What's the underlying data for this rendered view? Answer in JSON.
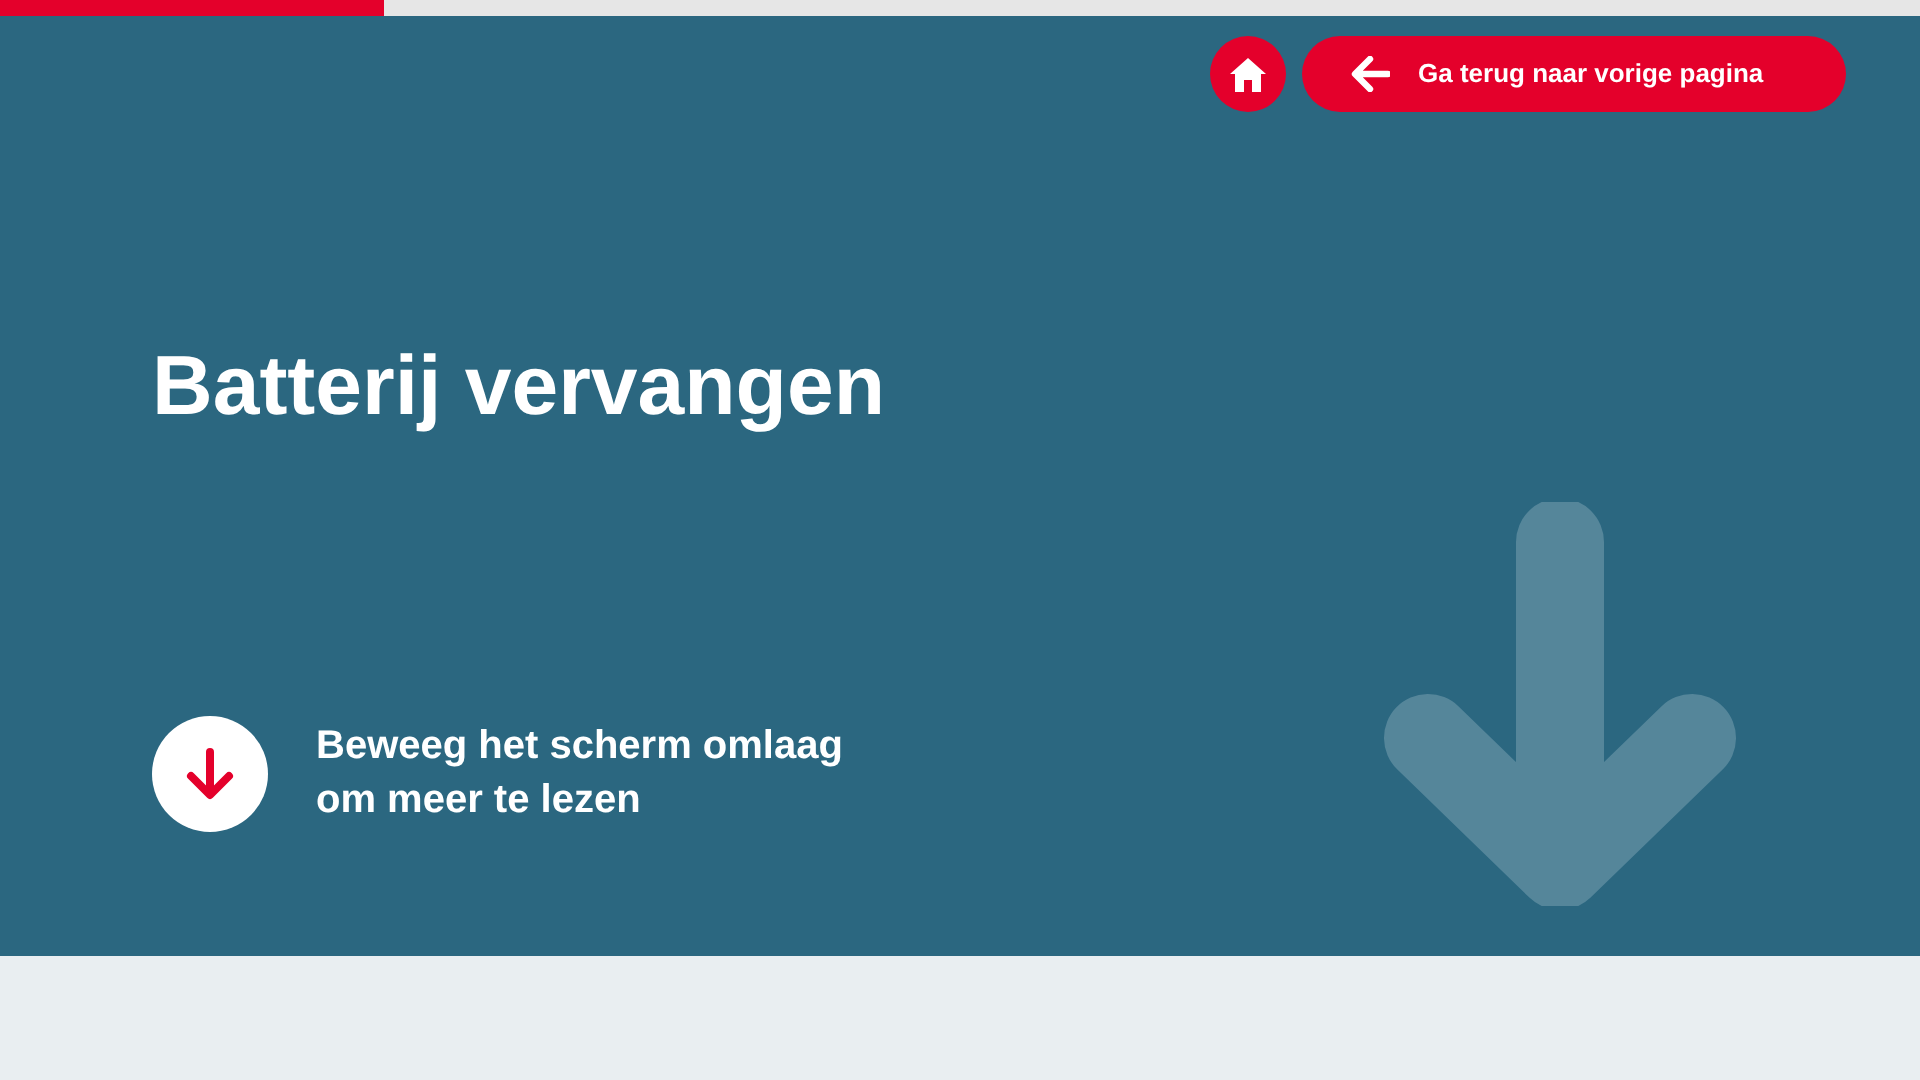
{
  "progress": {
    "level": 0.2
  },
  "nav": {
    "back_label": "Ga terug naar vorige pagina"
  },
  "title": "Batterij vervangen",
  "scroll_hint": "Beweeg het scherm omlaag om meer te lezen"
}
